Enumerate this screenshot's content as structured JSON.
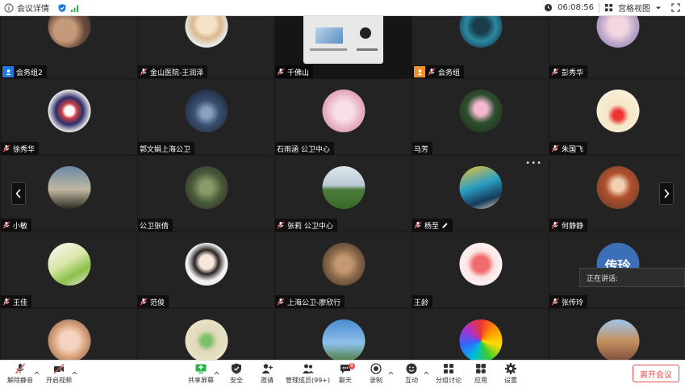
{
  "topbar": {
    "title": "会议详情",
    "time": "06:08:56",
    "view_label": "宫格视图"
  },
  "tiles": [
    {
      "name": "会务组2",
      "badge": "host-blue"
    },
    {
      "name": "金山医院-王润泽",
      "badge": "muted"
    },
    {
      "name": "千佛山",
      "badge": "muted"
    },
    {
      "name": "会务组",
      "badge": "host-orange"
    },
    {
      "name": "彭秀华",
      "badge": "muted"
    },
    {
      "name": "徐秀华",
      "badge": "muted"
    },
    {
      "name": "郭文娟上海公卫",
      "badge": "none"
    },
    {
      "name": "石雨涵 公卫中心",
      "badge": "none"
    },
    {
      "name": "马芳",
      "badge": "none"
    },
    {
      "name": "朱国飞",
      "badge": "muted"
    },
    {
      "name": "小敏",
      "badge": "muted"
    },
    {
      "name": "公卫张倩",
      "badge": "none"
    },
    {
      "name": "张莉 公卫中心",
      "badge": "muted"
    },
    {
      "name": "杨至",
      "badge": "muted"
    },
    {
      "name": "何静静",
      "badge": "muted"
    },
    {
      "name": "王佳",
      "badge": "muted"
    },
    {
      "name": "范俊",
      "badge": "muted"
    },
    {
      "name": "上海公卫-廖欣行",
      "badge": "muted"
    },
    {
      "name": "王龄",
      "badge": "none"
    },
    {
      "name": "张传玲",
      "badge": "muted"
    }
  ],
  "talking_label": "正在讲话:",
  "avatar_text": "传玲",
  "toolbar": {
    "unmute": "解除静音",
    "start_video": "开启视频",
    "share": "共享屏幕",
    "security": "安全",
    "invite": "邀请",
    "members": "管理成员(99+)",
    "chat": "聊天",
    "chat_badge": "8",
    "record": "录制",
    "reactions": "互动",
    "breakout": "分组讨论",
    "apps": "应用",
    "settings": "设置",
    "leave": "离开会议"
  },
  "colors": {
    "accent_green": "#2bb34b",
    "leave_red": "#e94c4c",
    "host_blue": "#1f7ae0",
    "host_orange": "#f0902c"
  }
}
